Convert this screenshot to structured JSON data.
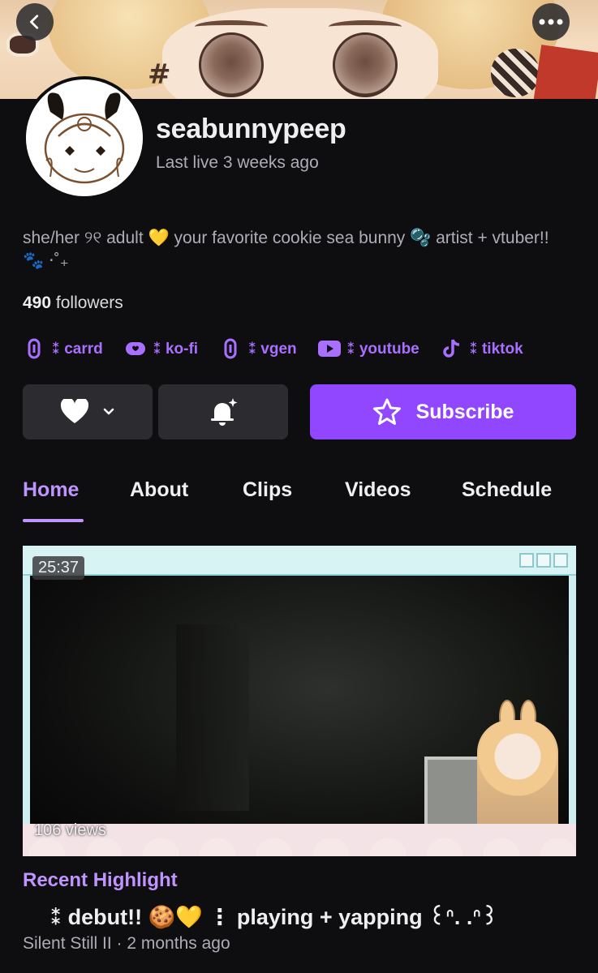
{
  "header": {
    "back_icon": "chevron-left-icon",
    "more_icon": "more-horizontal-icon"
  },
  "channel": {
    "name": "seabunnypeep",
    "last_live": "Last live 3 weeks ago",
    "bio": "she/her ୨୧ adult 💛 your favorite cookie sea bunny 🫧 artist + vtuber!! 🐾 ⋅˚₊",
    "followers_count": "490",
    "followers_label": "followers"
  },
  "links": [
    {
      "label": "⁑ carrd",
      "icon": "link-icon"
    },
    {
      "label": "⁑ ko-fi",
      "icon": "kofi-icon"
    },
    {
      "label": "⁑ vgen",
      "icon": "link-icon"
    },
    {
      "label": "⁑ youtube",
      "icon": "youtube-icon"
    },
    {
      "label": "⁑ tiktok",
      "icon": "tiktok-icon"
    }
  ],
  "actions": {
    "follow_icon": "heart-icon",
    "notify_icon": "bell-icon",
    "subscribe_label": "Subscribe"
  },
  "tabs": [
    {
      "label": "Home",
      "active": true
    },
    {
      "label": "About",
      "active": false
    },
    {
      "label": "Clips",
      "active": false
    },
    {
      "label": "Videos",
      "active": false
    },
    {
      "label": "Schedule",
      "active": false
    }
  ],
  "highlight": {
    "duration": "25:37",
    "views": "106 views",
    "section_label": "Recent Highlight",
    "title": "⁑ debut!! 🍪💛 ⋮ playing + yapping ꒰ᐢ. .ᐢ꒱",
    "meta": "Silent Still II · 2 months ago"
  },
  "colors": {
    "accent": "#9147ff",
    "accent_text": "#bf94ff",
    "background": "#0e0e10",
    "button_dark": "#2b2b30"
  }
}
